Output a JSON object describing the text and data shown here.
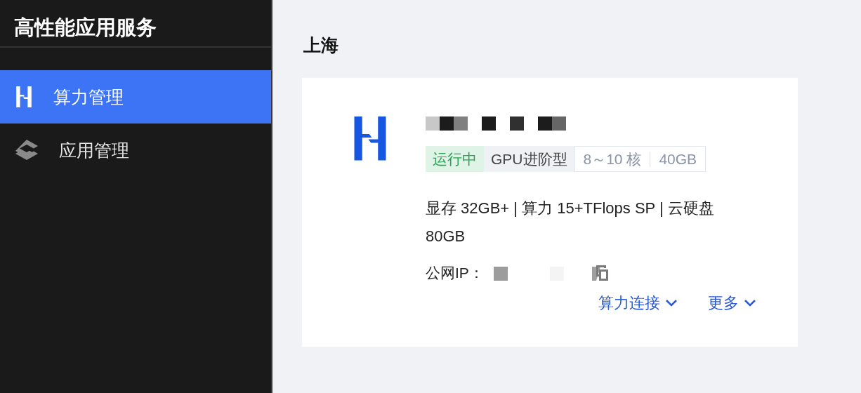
{
  "sidebar": {
    "title": "高性能应用服务",
    "items": [
      {
        "label": "算力管理",
        "selected": true
      },
      {
        "label": "应用管理",
        "selected": false
      }
    ]
  },
  "region": "上海",
  "instance": {
    "tags": [
      {
        "kind": "status",
        "label": "运行中"
      },
      {
        "kind": "type",
        "label": "GPU进阶型"
      },
      {
        "kind": "spec",
        "parts": [
          "8～10 核",
          "40GB"
        ]
      }
    ],
    "specs": "显存 32GB+ | 算力 15+TFlops SP | 云硬盘 80GB",
    "ip_label": "公网IP：",
    "actions": [
      "算力连接",
      "更多"
    ]
  }
}
